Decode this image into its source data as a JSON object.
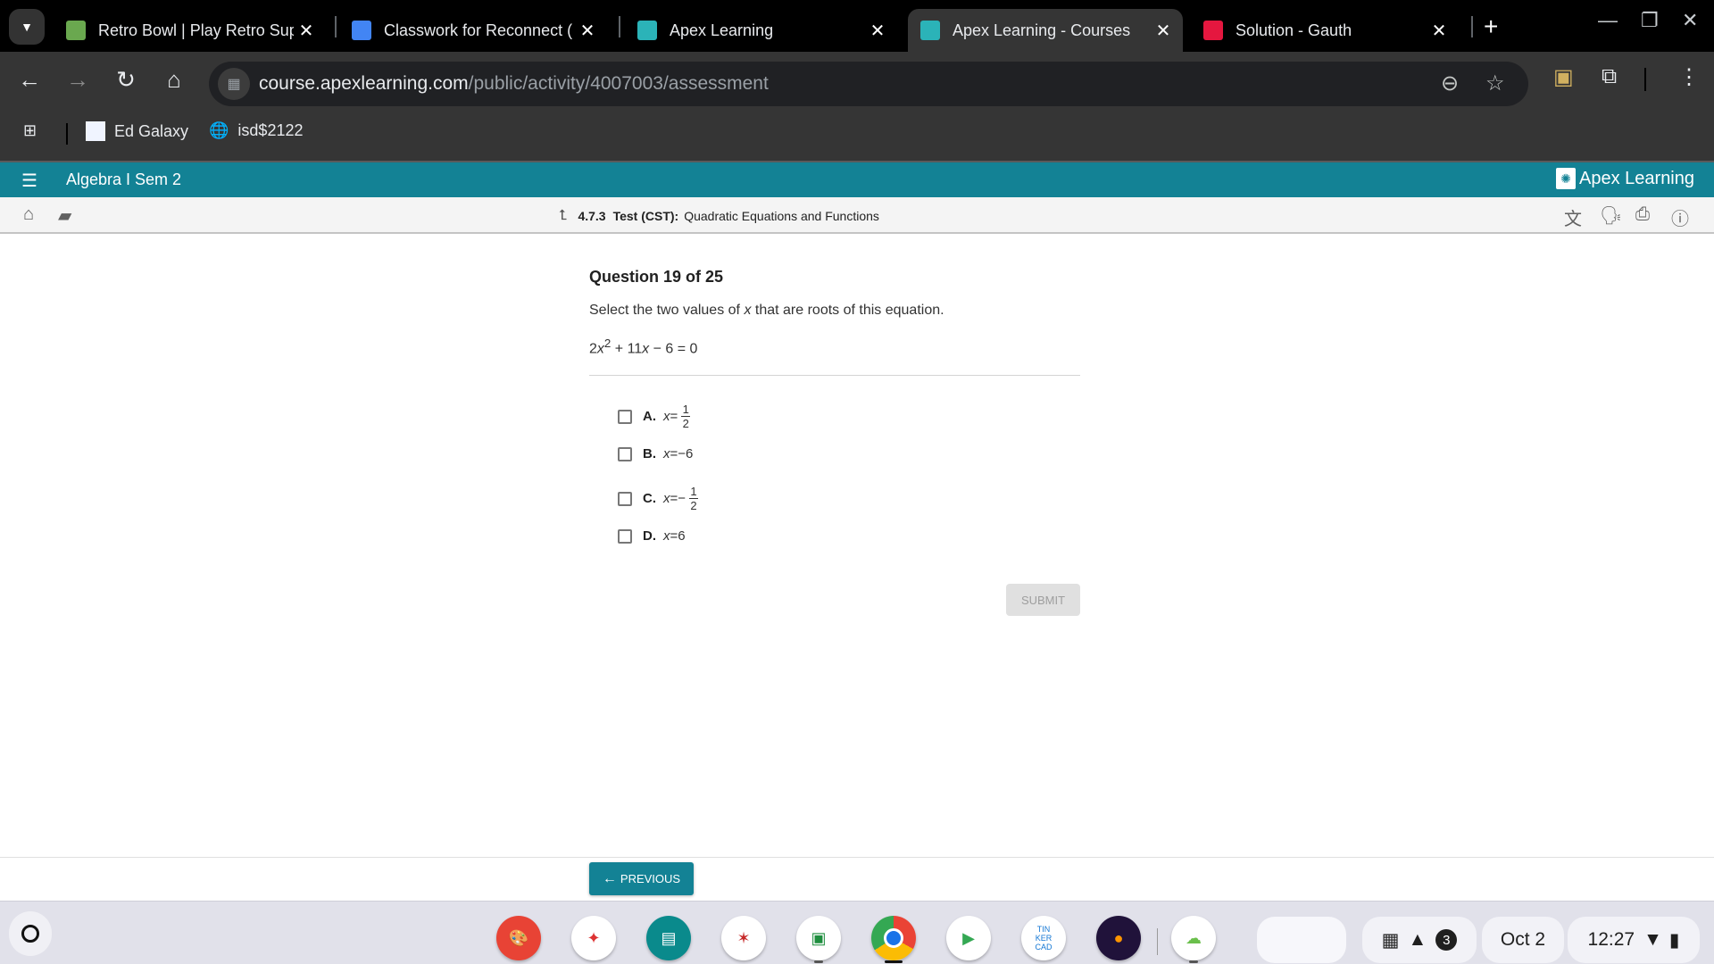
{
  "browser": {
    "tabs": [
      {
        "title": "Retro Bowl | Play Retro Sup",
        "favicon": "retro-bowl-icon",
        "active": false
      },
      {
        "title": "Classwork for Reconnect (",
        "favicon": "google-classroom-icon",
        "active": false
      },
      {
        "title": "Apex Learning",
        "favicon": "apex-icon",
        "active": false
      },
      {
        "title": "Apex Learning - Courses",
        "favicon": "apex-icon",
        "active": true
      },
      {
        "title": "Solution - Gauth",
        "favicon": "gauth-icon",
        "active": false
      }
    ],
    "new_tab": "+",
    "close_glyph": "✕",
    "url_host": "course.apexlearning.com",
    "url_path": "/public/activity/4007003/assessment",
    "bookmarks": [
      {
        "label": "Ed Galaxy",
        "icon": "ed-galaxy-icon"
      },
      {
        "label": "isd$2122",
        "icon": "globe-icon"
      }
    ]
  },
  "apex": {
    "course_title": "Algebra I Sem 2",
    "logo_text": "Apex Learning",
    "brand_color": "#138295",
    "breadcrumb": {
      "number": "4.7.3",
      "type": "Test (CST):",
      "title": "Quadratic Equations and Functions"
    }
  },
  "question": {
    "header": "Question 19 of 25",
    "prompt_before": "Select the two values of ",
    "prompt_var": "x",
    "prompt_after": " that are roots of this equation.",
    "equation": {
      "lead": "2",
      "var": "x",
      "exp": "2",
      "mid": " + 11",
      "var2": "x",
      "tail": " − 6 = 0"
    },
    "options": [
      {
        "letter": "A.",
        "lhs": "x",
        "eq": " = ",
        "sign": "",
        "whole": "",
        "num": "1",
        "den": "2",
        "checked": false
      },
      {
        "letter": "B.",
        "lhs": "x",
        "eq": " = ",
        "sign": "",
        "whole": "−6",
        "num": "",
        "den": "",
        "checked": false
      },
      {
        "letter": "C.",
        "lhs": "x",
        "eq": " = ",
        "sign": "−",
        "whole": "",
        "num": "1",
        "den": "2",
        "checked": false
      },
      {
        "letter": "D.",
        "lhs": "x",
        "eq": " = ",
        "sign": "",
        "whole": "6",
        "num": "",
        "den": "",
        "checked": false
      }
    ],
    "submit_label": "SUBMIT",
    "previous_label": "PREVIOUS"
  },
  "shelf": {
    "apps": [
      "paint-app-icon",
      "physics-app-icon",
      "screencast-app-icon",
      "anatomy-app-icon",
      "google-classroom-icon",
      "chrome-icon",
      "play-store-icon",
      "tinkercad-icon",
      "firefox-icon",
      "cloud-app-icon"
    ],
    "tinkercad_text": "TIN KER CAD",
    "notification_count": "3",
    "date": "Oct 2",
    "time": "12:27"
  }
}
